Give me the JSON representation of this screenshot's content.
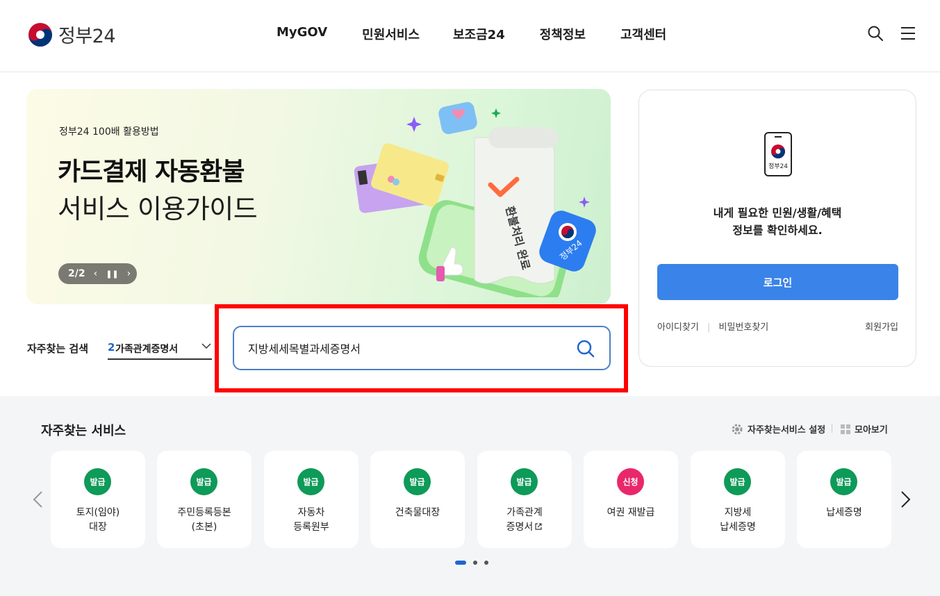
{
  "header": {
    "logo_text": "정부24",
    "nav": [
      "MyGOV",
      "민원서비스",
      "보조금24",
      "정책정보",
      "고객센터"
    ]
  },
  "banner": {
    "subtitle": "정부24 100배 활용방법",
    "title": "카드결제 자동환불",
    "title2": "서비스 이용가이드",
    "counter": "2/2",
    "art_text": "환불처리 완료",
    "art_badge": "정부24"
  },
  "login": {
    "icon_text": "정부24",
    "message_line1": "내게 필요한 민원/생활/혜택",
    "message_line2": "정보를 확인하세요.",
    "button": "로그인",
    "find_id": "아이디찾기",
    "find_pw": "비밀번호찾기",
    "signup": "회원가입"
  },
  "search": {
    "freq_label": "자주찾는 검색",
    "freq_num": "2",
    "freq_text": "가족관계증명서",
    "value": "지방세세목별과세증명서"
  },
  "services": {
    "title": "자주찾는 서비스",
    "setting": "자주찾는서비스 설정",
    "view_all": "모아보기",
    "cards": [
      {
        "badge": "발급",
        "color": "green",
        "line1": "토지(임야)",
        "line2": "대장"
      },
      {
        "badge": "발급",
        "color": "green",
        "line1": "주민등록등본",
        "line2": "(초본)"
      },
      {
        "badge": "발급",
        "color": "green",
        "line1": "자동차",
        "line2": "등록원부"
      },
      {
        "badge": "발급",
        "color": "green",
        "line1": "건축물대장",
        "line2": ""
      },
      {
        "badge": "발급",
        "color": "green",
        "line1": "가족관계",
        "line2": "증명서"
      },
      {
        "badge": "신청",
        "color": "pink",
        "line1": "여권 재발급",
        "line2": ""
      },
      {
        "badge": "발급",
        "color": "green",
        "line1": "지방세",
        "line2": "납세증명"
      },
      {
        "badge": "발급",
        "color": "green",
        "line1": "납세증명",
        "line2": ""
      }
    ]
  }
}
